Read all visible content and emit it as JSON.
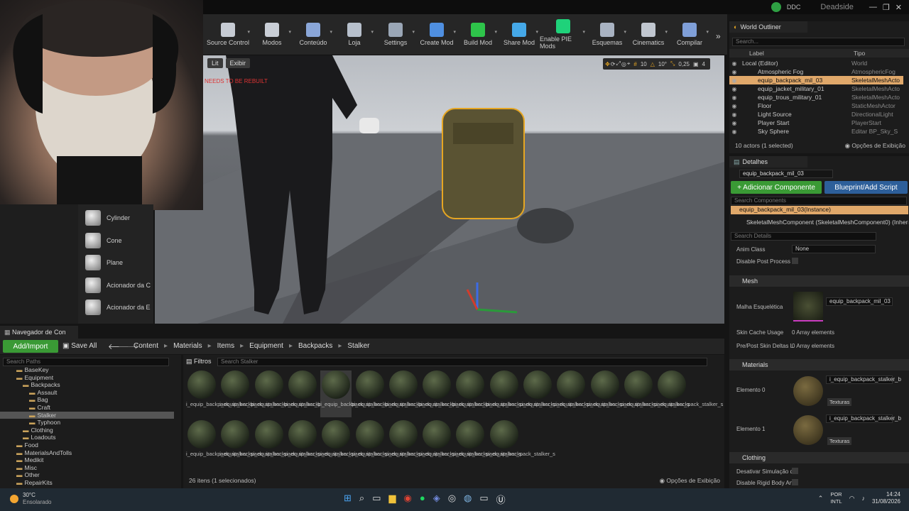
{
  "topbar": {
    "ddc": "DDC",
    "project": "Deadside"
  },
  "toolbar": [
    {
      "label": "Source Control",
      "color": "#c6cbd3"
    },
    {
      "label": "Modos",
      "color": "#c9ced6"
    },
    {
      "label": "Conteúdo",
      "color": "#8aa6d8"
    },
    {
      "label": "Loja",
      "color": "#b7c0cc"
    },
    {
      "label": "Settings",
      "color": "#9aa6b6"
    },
    {
      "label": "Create Mod",
      "color": "#4f8fe0"
    },
    {
      "label": "Build Mod",
      "color": "#2ec44a"
    },
    {
      "label": "Share Mod",
      "color": "#45a8e8"
    },
    {
      "label": "Enable PIE Mods",
      "color": "#1fd27a"
    },
    {
      "label": "Esquemas",
      "color": "#a9b3c2"
    },
    {
      "label": "Cinematics",
      "color": "#c0c6cf"
    },
    {
      "label": "Compilar",
      "color": "#7f9fd8"
    }
  ],
  "viewport": {
    "lit": "Lit",
    "exibir": "Exibir",
    "warning": "NEEDS TO BE REBUILT",
    "snap_value": "10",
    "angle": "10°",
    "scale": "0,25",
    "cam": "4"
  },
  "placement": [
    {
      "label": "Cylinder"
    },
    {
      "label": "Cone"
    },
    {
      "label": "Plane"
    },
    {
      "label": "Acionador da C"
    },
    {
      "label": "Acionador da E"
    }
  ],
  "outliner": {
    "title": "World Outliner",
    "search": "Search...",
    "col_label": "Label",
    "col_type": "Tipo",
    "rows": [
      {
        "label": "Local (Editor)",
        "type": "World"
      },
      {
        "label": "Atmospheric Fog",
        "type": "AtmosphericFog"
      },
      {
        "label": "equip_backpack_mil_03",
        "type": "SkeletalMeshActo"
      },
      {
        "label": "equip_jacket_military_01",
        "type": "SkeletalMeshActo"
      },
      {
        "label": "equip_trous_military_01",
        "type": "SkeletalMeshActo"
      },
      {
        "label": "Floor",
        "type": "StaticMeshActor"
      },
      {
        "label": "Light Source",
        "type": "DirectionalLight"
      },
      {
        "label": "Player Start",
        "type": "PlayerStart"
      },
      {
        "label": "Sky Sphere",
        "type": "Editar BP_Sky_S"
      }
    ],
    "footer": "10 actors (1 selected)",
    "view_opts": "Opções de Exibição"
  },
  "details": {
    "title": "Detalhes",
    "name": "equip_backpack_mil_03",
    "add_component": "+ Adicionar Componente",
    "blueprint": "Blueprint/Add Script",
    "search_components": "Search Components",
    "instance": "equip_backpack_mil_03(Instance)",
    "component": "SkeletalMeshComponent (SkeletalMeshComponent0) (Inherited)",
    "search_details": "Search Details",
    "anim_class": "Anim Class",
    "anim_value": "None",
    "disable_post": "Disable Post Process",
    "mesh_section": "Mesh",
    "mesh_label": "Malha Esquelética",
    "mesh_value": "equip_backpack_mil_03",
    "skin_cache": "Skin Cache Usage",
    "skin_value": "0 Array elements",
    "prepost": "Pre/Post Skin Deltas L",
    "prepost_value": "0 Array elements",
    "materials_section": "Materials",
    "elem0": "Elemento 0",
    "elem1": "Elemento 1",
    "mat_value": "i_equip_backpack_stalker_b",
    "texturas": "Texturas",
    "clothing_section": "Clothing",
    "desativar": "Desativar Simulação d",
    "disable_rigid": "Disable Rigid Body Ani"
  },
  "content_browser": {
    "tab": "Navegador de Con",
    "add_import": "Add/Import",
    "save_all": "Save All",
    "breadcrumb": [
      "Content",
      "Materials",
      "Items",
      "Equipment",
      "Backpacks",
      "Stalker"
    ],
    "search_paths": "Search Paths",
    "filters": "Filtros",
    "search_assets": "Search Stalker",
    "tree": [
      {
        "label": "BaseKey",
        "indent": 1
      },
      {
        "label": "Equipment",
        "indent": 1
      },
      {
        "label": "Backpacks",
        "indent": 2
      },
      {
        "label": "Assault",
        "indent": 3
      },
      {
        "label": "Bag",
        "indent": 3
      },
      {
        "label": "Craft",
        "indent": 3
      },
      {
        "label": "Stalker",
        "indent": 3
      },
      {
        "label": "Typhoon",
        "indent": 3
      },
      {
        "label": "Clothing",
        "indent": 2
      },
      {
        "label": "Loadouts",
        "indent": 2
      },
      {
        "label": "Food",
        "indent": 1
      },
      {
        "label": "MaterialsAndTolls",
        "indent": 1
      },
      {
        "label": "Medikit",
        "indent": 1
      },
      {
        "label": "Misc",
        "indent": 1
      },
      {
        "label": "Other",
        "indent": 1
      },
      {
        "label": "RepairKits",
        "indent": 1
      }
    ],
    "assets_row1": [
      "i_equip_backpack_stalker_b",
      "i_equip_backpack_stalker_b",
      "i_equip_backpack_stalker_b",
      "i_equip_backpack_stalker_b",
      "i_equip_backpack_stalker_b",
      "i_equip_backpack_stalker_b",
      "i_equip_backpack_stalker_b",
      "i_equip_backpack_stalker_b",
      "i_equip_backpack_stalker_s",
      "i_equip_backpack_stalker_s",
      "i_equip_backpack_stalker_s",
      "i_equip_backpack_stalker_s",
      "i_equip_backpack_stalker_s",
      "i_equip_backpack_stalker_s",
      "i_equip_backpack_stalker_s"
    ],
    "assets_row2": [
      "i_equip_backpack_stalker_s",
      "i_equip_backpack_stalker_s",
      "i_equip_backpack_stalker_s",
      "i_equip_backpack_stalker_s",
      "i_equip_backpack_stalker_s",
      "i_equip_backpack_stalker_s",
      "i_equip_backpack_stalker_s",
      "i_equip_backpack_stalker_s",
      "i_equip_backpack_stalker_s",
      "i_equip_backpack_stalker_s"
    ],
    "footer": "26 itens (1 selecionados)",
    "view_opts": "Opções de Exibição"
  },
  "taskbar": {
    "temp": "30°C",
    "weather": "Ensolarado",
    "lang1": "POR",
    "lang2": "INTL",
    "time": "14:24",
    "date": "31/08/2026"
  }
}
